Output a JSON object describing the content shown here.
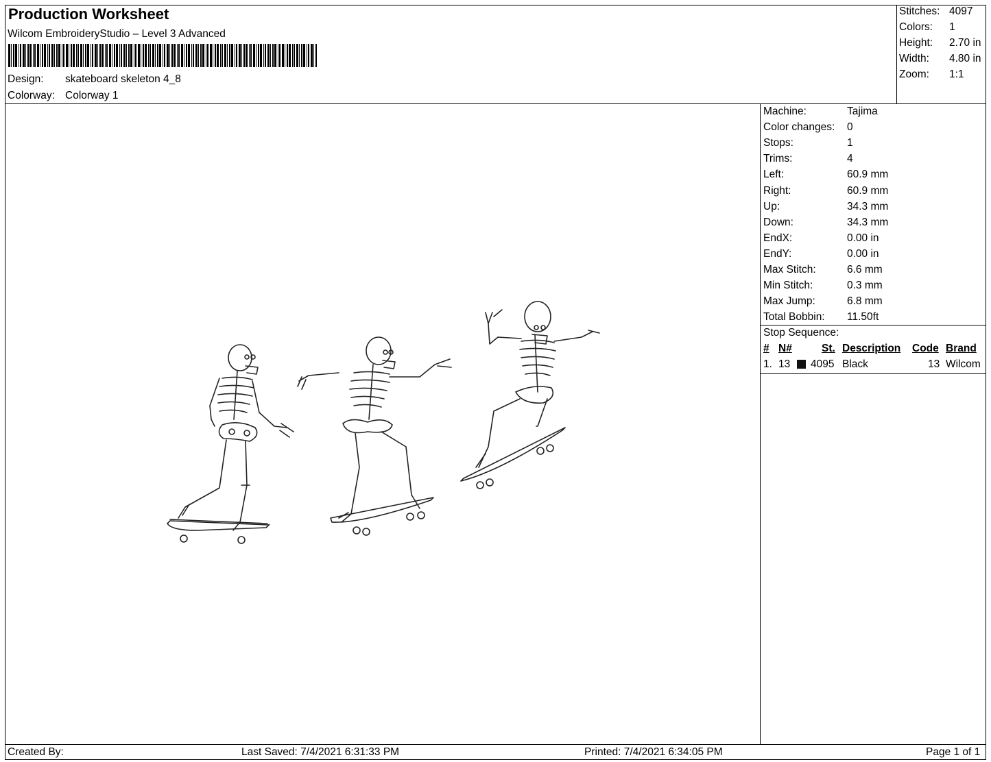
{
  "header": {
    "title": "Production Worksheet",
    "subtitle": "Wilcom EmbroideryStudio – Level 3 Advanced",
    "design_label": "Design:",
    "design_value": "skateboard skeleton 4_8",
    "colorway_label": "Colorway:",
    "colorway_value": "Colorway 1"
  },
  "summary": [
    {
      "label": "Stitches:",
      "value": "4097"
    },
    {
      "label": "Colors:",
      "value": "1"
    },
    {
      "label": "Height:",
      "value": "2.70 in"
    },
    {
      "label": "Width:",
      "value": "4.80 in"
    },
    {
      "label": "Zoom:",
      "value": "1:1"
    }
  ],
  "machine_stats": [
    {
      "label": "Machine:",
      "value": "Tajima"
    },
    {
      "label": "Color changes:",
      "value": "0"
    },
    {
      "label": "Stops:",
      "value": "1"
    },
    {
      "label": "Trims:",
      "value": "4"
    },
    {
      "label": "Left:",
      "value": "60.9 mm"
    },
    {
      "label": "Right:",
      "value": "60.9 mm"
    },
    {
      "label": "Up:",
      "value": "34.3 mm"
    },
    {
      "label": "Down:",
      "value": "34.3 mm"
    },
    {
      "label": "EndX:",
      "value": "0.00 in"
    },
    {
      "label": "EndY:",
      "value": "0.00 in"
    },
    {
      "label": "Max Stitch:",
      "value": "6.6 mm"
    },
    {
      "label": "Min Stitch:",
      "value": "0.3 mm"
    },
    {
      "label": "Max Jump:",
      "value": "6.8 mm"
    },
    {
      "label": "Total Bobbin:",
      "value": "11.50ft"
    }
  ],
  "stop_sequence": {
    "title": "Stop Sequence:",
    "columns": [
      "#",
      "N#",
      "St.",
      "Description",
      "Code",
      "Brand"
    ],
    "rows": [
      {
        "num": "1.",
        "needle": "13",
        "swatch_color": "#111111",
        "stitches": "4095",
        "description": "Black",
        "code": "13",
        "brand": "Wilcom"
      }
    ]
  },
  "footer": {
    "created_by": "Created By:",
    "last_saved": "Last Saved: 7/4/2021 6:31:33 PM",
    "printed": "Printed: 7/4/2021 6:34:05 PM",
    "page": "Page 1 of 1"
  }
}
